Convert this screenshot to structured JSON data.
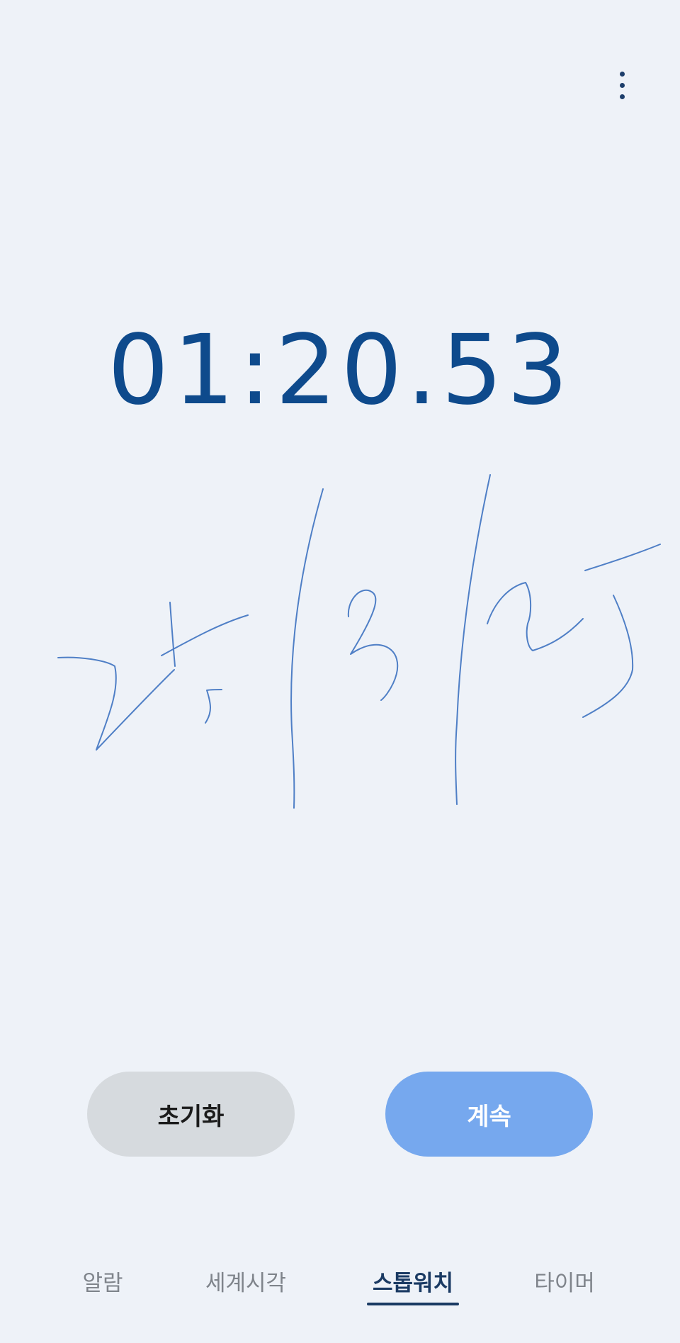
{
  "stopwatch": {
    "elapsed": "01:20.53"
  },
  "buttons": {
    "reset_label": "초기화",
    "continue_label": "계속"
  },
  "tabs": [
    {
      "label": "알람",
      "active": false
    },
    {
      "label": "세계시각",
      "active": false
    },
    {
      "label": "스톱워치",
      "active": true
    },
    {
      "label": "타이머",
      "active": false
    }
  ],
  "icons": {
    "more": "more-vertical-icon"
  },
  "colors": {
    "background": "#eef2f8",
    "time": "#0e4a8c",
    "continue_button": "#76a8ee",
    "reset_button": "#d6dade",
    "active_tab": "#1a3a63",
    "inactive_tab": "#7f848b",
    "ink": "#4f7fc6"
  }
}
